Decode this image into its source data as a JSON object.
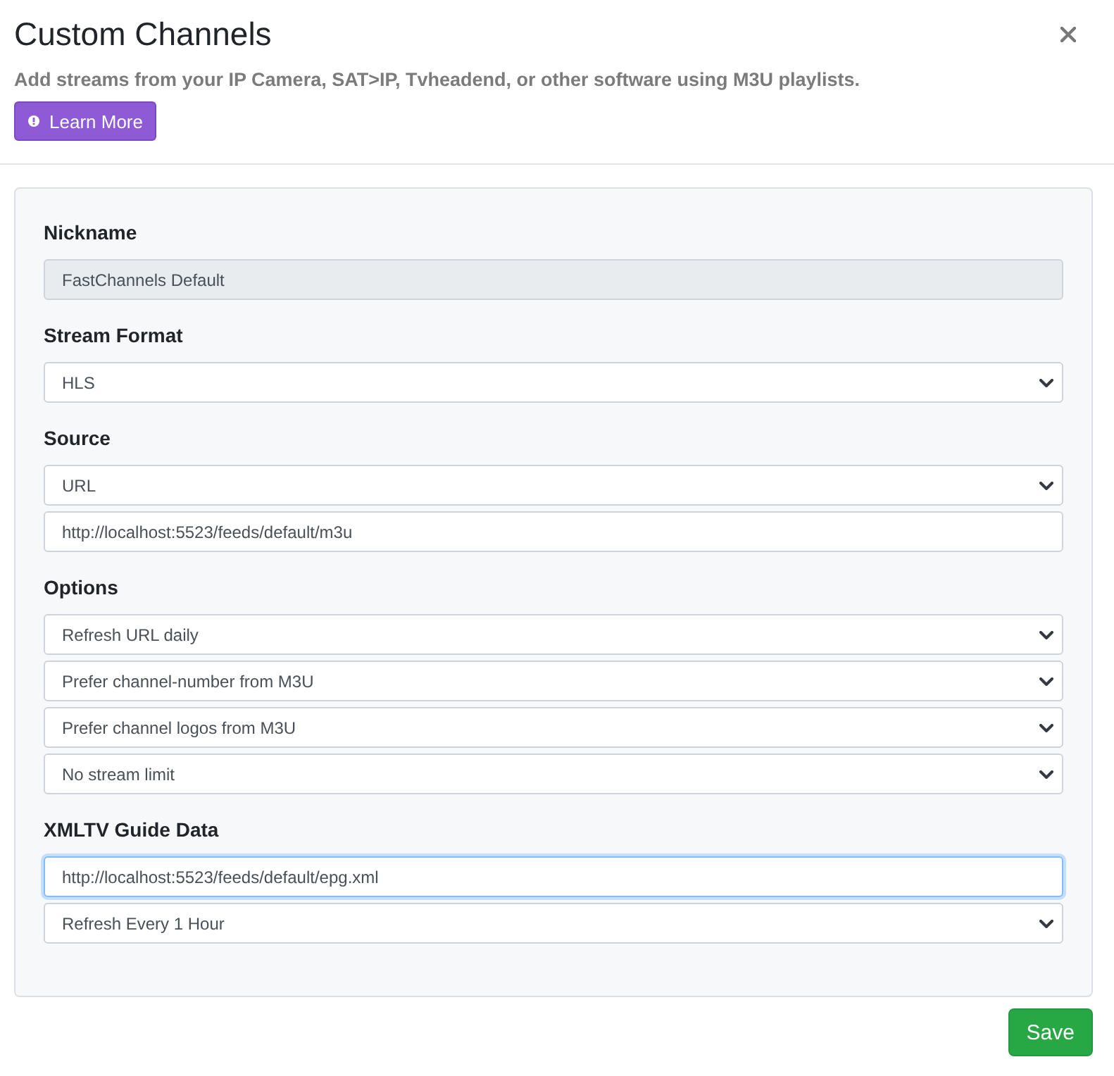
{
  "dialog": {
    "title": "Custom Channels",
    "description": "Add streams from your IP Camera, SAT>IP, Tvheadend, or other software using M3U playlists.",
    "learn_more_button": "Learn More"
  },
  "form": {
    "sections": [
      {
        "label": "Nickname",
        "fields": [
          {
            "kind": "input",
            "value": "FastChannels Default",
            "disabled": true,
            "focused": false
          }
        ]
      },
      {
        "label": "Stream Format",
        "fields": [
          {
            "kind": "select",
            "value": "HLS",
            "disabled": false,
            "focused": false
          }
        ]
      },
      {
        "label": "Source",
        "fields": [
          {
            "kind": "select",
            "value": "URL",
            "disabled": false,
            "focused": false
          },
          {
            "kind": "input",
            "value": "http://localhost:5523/feeds/default/m3u",
            "disabled": false,
            "focused": false
          }
        ]
      },
      {
        "label": "Options",
        "fields": [
          {
            "kind": "select",
            "value": "Refresh URL daily",
            "disabled": false,
            "focused": false
          },
          {
            "kind": "select",
            "value": "Prefer channel-number from M3U",
            "disabled": false,
            "focused": false
          },
          {
            "kind": "select",
            "value": "Prefer channel logos from M3U",
            "disabled": false,
            "focused": false
          },
          {
            "kind": "select",
            "value": "No stream limit",
            "disabled": false,
            "focused": false
          }
        ]
      },
      {
        "label": "XMLTV Guide Data",
        "fields": [
          {
            "kind": "input",
            "value": "http://localhost:5523/feeds/default/epg.xml",
            "disabled": false,
            "focused": true
          },
          {
            "kind": "select",
            "value": "Refresh Every 1 Hour",
            "disabled": false,
            "focused": false
          }
        ]
      }
    ]
  },
  "footer": {
    "save_button": "Save"
  }
}
